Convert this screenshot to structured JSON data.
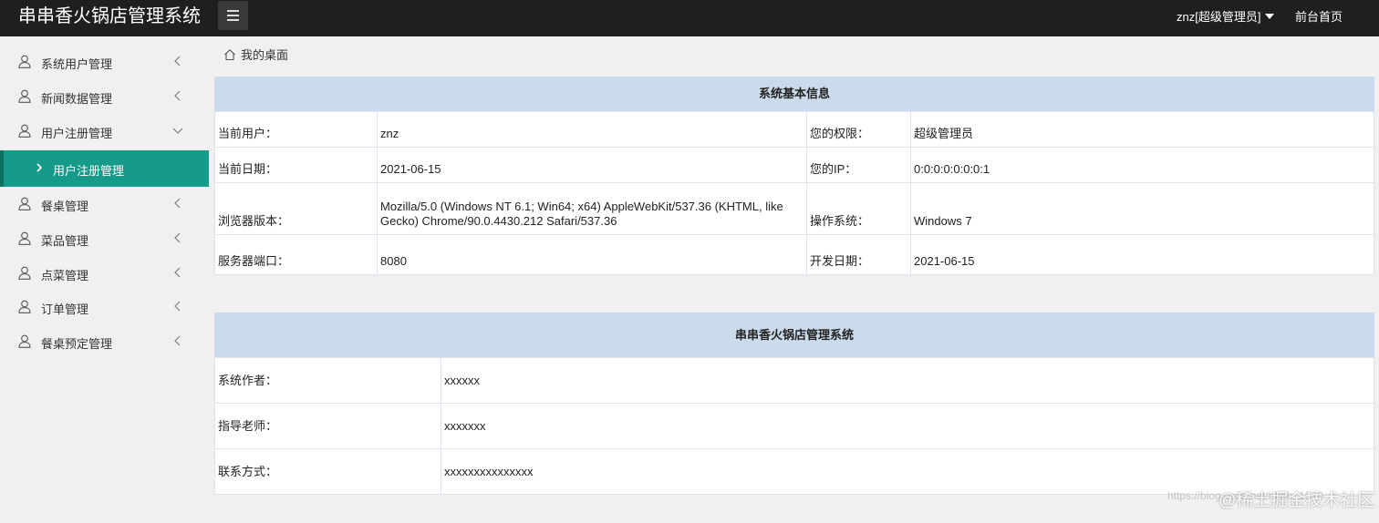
{
  "header": {
    "title": "串串香火锅店管理系统",
    "user": "znz[超级管理员]",
    "front_link": "前台首页"
  },
  "sidebar": {
    "items": [
      {
        "label": "系统用户管理",
        "icon": "user-icon",
        "expanded": false
      },
      {
        "label": "新闻数据管理",
        "icon": "user-icon",
        "expanded": false
      },
      {
        "label": "用户注册管理",
        "icon": "user-icon",
        "expanded": true
      },
      {
        "label": "餐桌管理",
        "icon": "user-icon",
        "expanded": false
      },
      {
        "label": "菜品管理",
        "icon": "user-icon",
        "expanded": false
      },
      {
        "label": "点菜管理",
        "icon": "user-icon",
        "expanded": false
      },
      {
        "label": "订单管理",
        "icon": "user-icon",
        "expanded": false
      },
      {
        "label": "餐桌预定管理",
        "icon": "user-icon",
        "expanded": false
      }
    ],
    "active_sub": "用户注册管理"
  },
  "breadcrumb": {
    "label": "我的桌面"
  },
  "system_info": {
    "title": "系统基本信息",
    "rows": [
      {
        "k1": "当前用户：",
        "v1": "znz",
        "k2": "您的权限：",
        "v2": "超级管理员"
      },
      {
        "k1": "当前日期：",
        "v1": "2021-06-15",
        "k2": "您的IP：",
        "v2": "0:0:0:0:0:0:0:1"
      },
      {
        "k1": "浏览器版本：",
        "v1": "Mozilla/5.0 (Windows NT 6.1; Win64; x64) AppleWebKit/537.36 (KHTML, like Gecko) Chrome/90.0.4430.212 Safari/537.36",
        "k2": "操作系统：",
        "v2": "Windows 7"
      },
      {
        "k1": "服务器端口：",
        "v1": "8080",
        "k2": "开发日期：",
        "v2": "2021-06-15"
      }
    ]
  },
  "about": {
    "title": "串串香火锅店管理系统",
    "rows": [
      {
        "k": "系统作者：",
        "v": "xxxxxx"
      },
      {
        "k": "指导老师：",
        "v": "xxxxxxx"
      },
      {
        "k": "联系方式：",
        "v": "xxxxxxxxxxxxxxx"
      }
    ]
  },
  "watermark": {
    "url": "https://blog.csdn.net/hhhh_1520",
    "brand": "@稀土掘金技术社区"
  },
  "colors": {
    "header_bg": "#1f1f1f",
    "active_bg": "#169b8a",
    "panel_head_bg": "#cbdbeb"
  }
}
